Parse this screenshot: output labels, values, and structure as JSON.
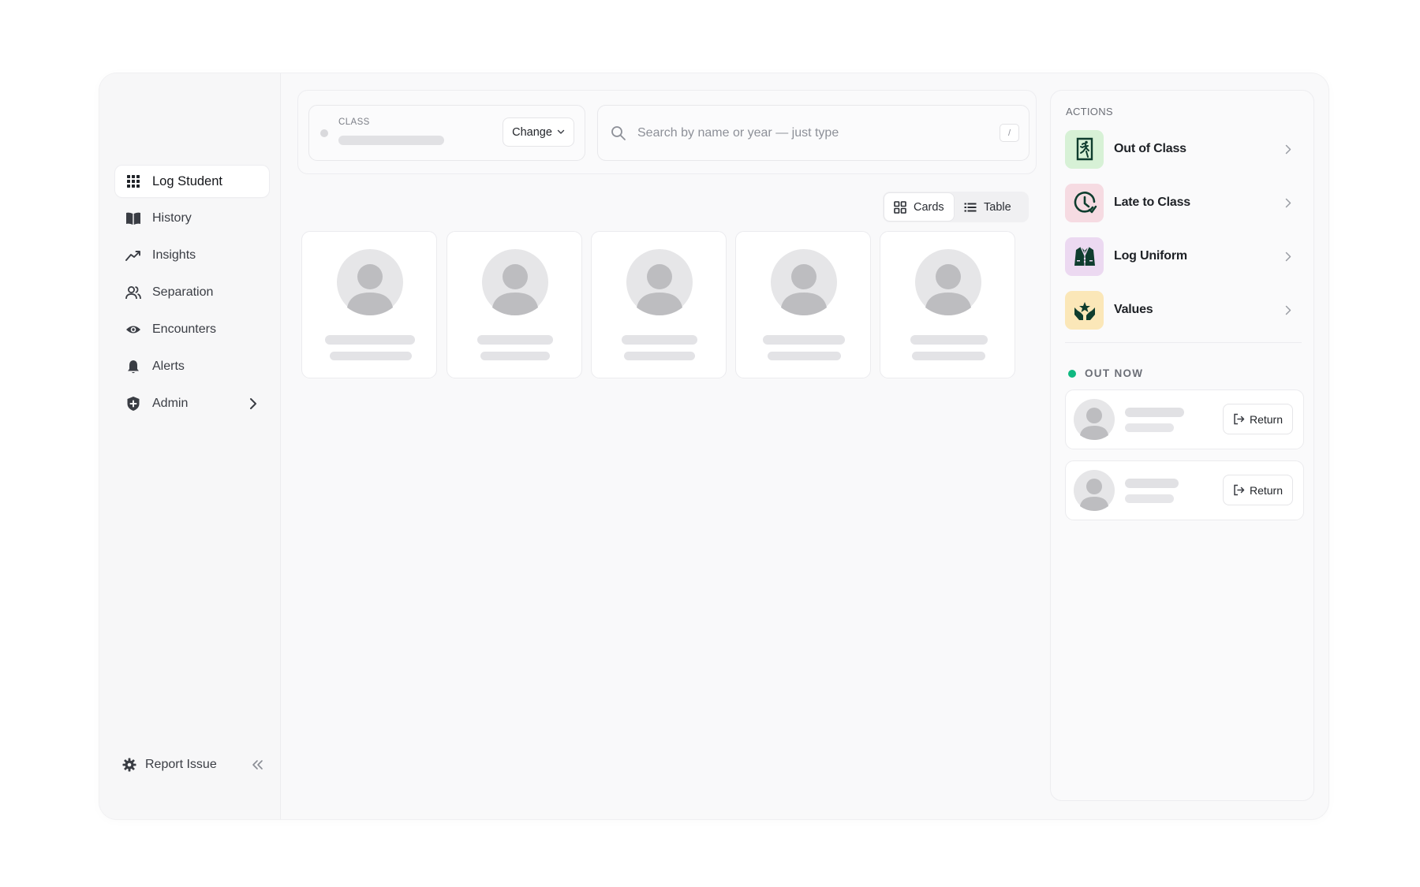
{
  "sidebar": {
    "items": [
      {
        "label": "Log Student",
        "icon": "grid-icon",
        "active": true
      },
      {
        "label": "History",
        "icon": "book-icon"
      },
      {
        "label": "Insights",
        "icon": "trend-icon"
      },
      {
        "label": "Separation",
        "icon": "users-icon"
      },
      {
        "label": "Encounters",
        "icon": "eye-icon"
      },
      {
        "label": "Alerts",
        "icon": "bell-icon"
      },
      {
        "label": "Admin",
        "icon": "shield-icon",
        "has_submenu": true
      }
    ],
    "footer": {
      "label": "Report Issue",
      "icon": "gear-icon",
      "collapse_icon": "double-chevron-left-icon"
    }
  },
  "topbar": {
    "class_label": "CLASS",
    "change_label": "Change",
    "search_placeholder": "Search by name or year — just type",
    "search_shortcut": "/"
  },
  "view_toggle": {
    "cards_label": "Cards",
    "table_label": "Table",
    "selected": "Cards"
  },
  "actions": {
    "title": "ACTIONS",
    "items": [
      {
        "label": "Out of Class",
        "icon": "exit-door-icon",
        "bg": "#d7f1d6"
      },
      {
        "label": "Late to Class",
        "icon": "clock-icon",
        "bg": "#f6dbe2"
      },
      {
        "label": "Log Uniform",
        "icon": "blazer-icon",
        "bg": "#ecd9f1"
      },
      {
        "label": "Values",
        "icon": "heart-hands-icon",
        "bg": "#fbe7b8"
      }
    ]
  },
  "out_now": {
    "title": "OUT NOW",
    "status_color": "#10b981",
    "return_label": "Return"
  },
  "colors": {
    "accent_dark": "#0f3d2e",
    "skeleton": "#e3e3e6",
    "background": "#f9f9fa"
  }
}
